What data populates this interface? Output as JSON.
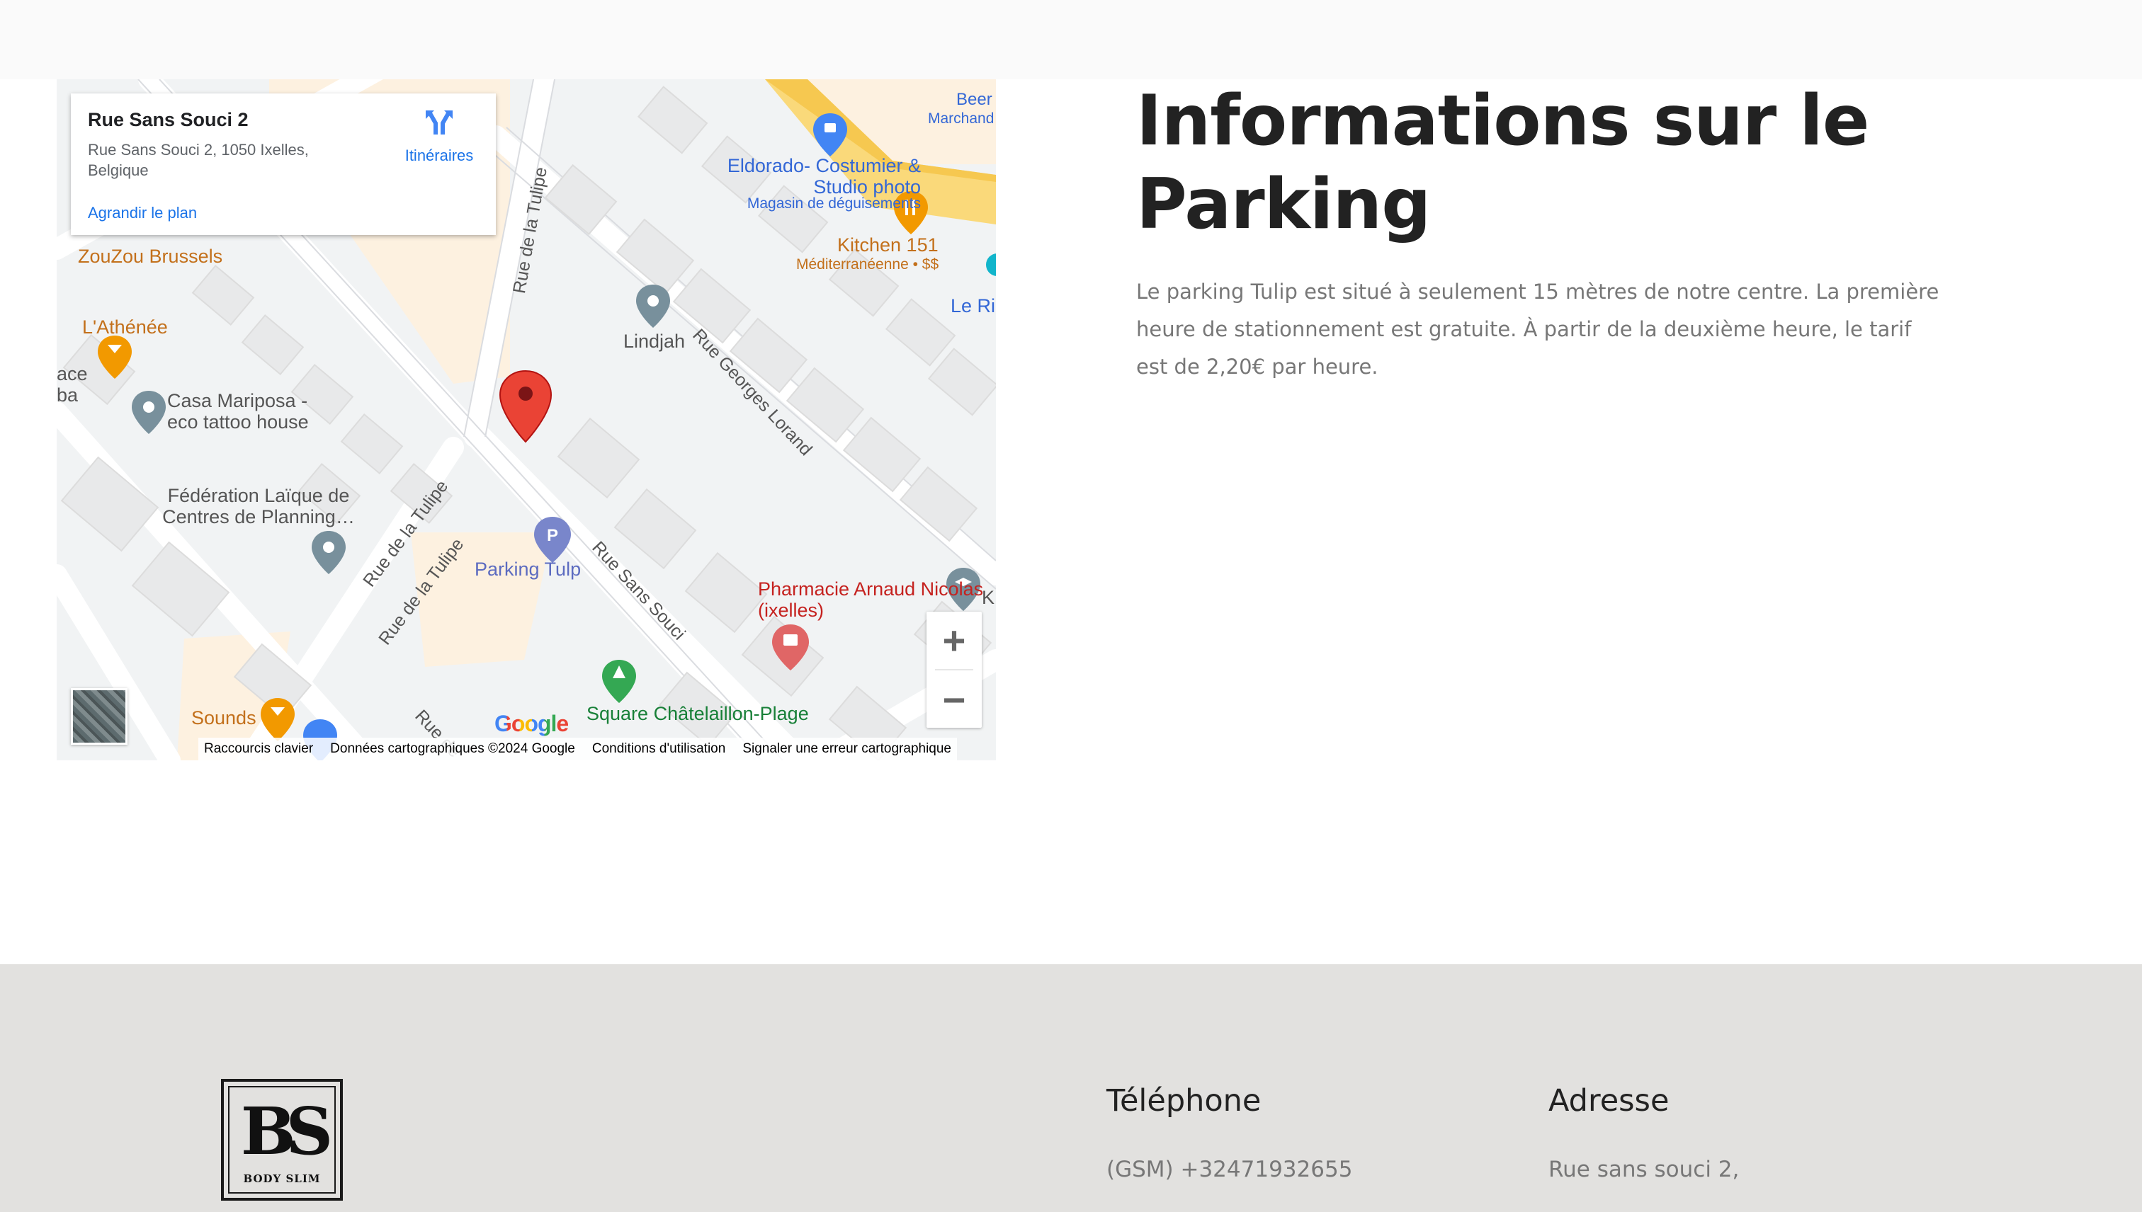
{
  "map": {
    "card": {
      "title": "Rue Sans Souci 2",
      "address": "Rue Sans Souci 2, 1050 Ixelles, Belgique",
      "enlarge_link": "Agrandir le plan",
      "directions_label": "Itinéraires"
    },
    "streets": {
      "rue_de_la_tulipe_top": "Rue de la Tulipe",
      "rue_georges_lorand": "Rue Georges Lorand",
      "rue_de_la_tulipe_mid": "Rue de la Tulipe",
      "rue_de_la_tulipe_low": "Rue de la Tulipe",
      "rue_sans_souci": "Rue Sans Souci",
      "rue_de_bottom": "Rue de"
    },
    "pois": {
      "beer": "Beer",
      "marchand": "Marchand",
      "eldorado": "Eldorado- Costumier & Studio photo",
      "eldorado_sub": "Magasin de déguisements",
      "kitchen": "Kitchen 151",
      "kitchen_sub": "Méditerranéenne • $$",
      "zouzou": "ZouZou Brussels",
      "athenee": "L'Athénée",
      "le_ri": "Le Ri",
      "lindjah": "Lindjah",
      "place": "ace",
      "place2": "ba",
      "casa": "Casa Mariposa - eco tattoo house",
      "federation": "Fédération Laïque de Centres de Planning…",
      "parking": "Parking Tulp",
      "pharmacie": "Pharmacie Arnaud Nicolas (ixelles)",
      "k_label": "K",
      "sounds": "Sounds",
      "square": "Square Châtelaillon-Plage"
    },
    "google_logo": "Google",
    "zoom_in": "+",
    "zoom_out": "−",
    "attribution": {
      "shortcuts": "Raccourcis clavier",
      "data": "Données cartographiques ©2024 Google",
      "terms": "Conditions d'utilisation",
      "report": "Signaler une erreur cartographique"
    }
  },
  "parking": {
    "heading": "Informations sur le Parking",
    "text": "Le parking Tulip est situé à seulement 15 mètres de notre centre. La première heure de stationnement est gratuite. À partir de la deuxième heure, le tarif est de 2,20€ par heure."
  },
  "footer": {
    "logo_mark": "BS",
    "logo_text": "BODY SLIM",
    "phone_heading": "Téléphone",
    "phone_value": "(GSM) +32471932655",
    "address_heading": "Adresse",
    "address_value": "Rue sans souci 2,"
  },
  "colors": {
    "footer_bg": "#e2e1df",
    "heading": "#222222",
    "body_text": "#777777",
    "map_link": "#1a73e8",
    "marker_red": "#ea4335"
  },
  "icons": [
    "directions-icon",
    "shopping-pin-icon",
    "restaurant-pin-icon",
    "pin-icon",
    "parking-pin-icon",
    "pharmacy-pin-icon",
    "education-pin-icon",
    "park-pin-icon",
    "bar-pin-icon",
    "location-marker-icon",
    "layers-icon"
  ]
}
